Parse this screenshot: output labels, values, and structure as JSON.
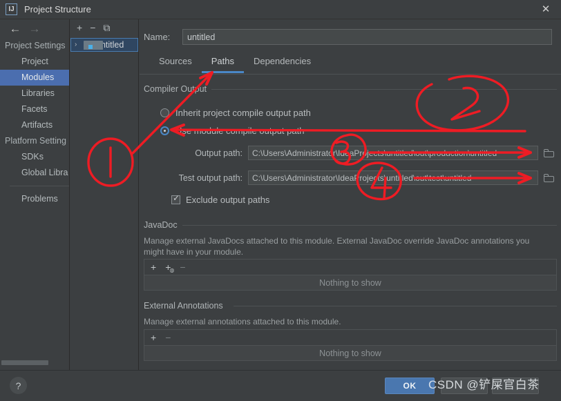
{
  "window": {
    "title": "Project Structure",
    "logo_text": "IJ",
    "close_icon": "✕"
  },
  "nav": {
    "back_icon": "←",
    "forward_icon": "→"
  },
  "sidebar": {
    "groups": [
      {
        "label": "Project Settings",
        "items": [
          {
            "label": "Project",
            "selected": false
          },
          {
            "label": "Modules",
            "selected": true
          },
          {
            "label": "Libraries",
            "selected": false
          },
          {
            "label": "Facets",
            "selected": false
          },
          {
            "label": "Artifacts",
            "selected": false
          }
        ]
      },
      {
        "label": "Platform Setting",
        "items": [
          {
            "label": "SDKs",
            "selected": false
          },
          {
            "label": "Global Libra",
            "selected": false
          }
        ]
      }
    ],
    "problems_label": "Problems"
  },
  "module_panel": {
    "toolbar": {
      "add_icon": "+",
      "remove_icon": "−",
      "copy_icon": "⧉"
    },
    "tree": [
      {
        "label": "untitled",
        "expander": "›",
        "selected": true
      }
    ]
  },
  "form": {
    "name_label": "Name:",
    "name_value": "untitled",
    "name_placeholder": "untitled",
    "tabs": [
      {
        "label": "Sources",
        "active": false
      },
      {
        "label": "Paths",
        "active": true
      },
      {
        "label": "Dependencies",
        "active": false
      }
    ],
    "compiler_output": {
      "section_title": "Compiler Output",
      "radio_inherit": "Inherit project compile output path",
      "radio_module": "Use module compile output path",
      "selected_radio": "module",
      "output_path_label": "Output path:",
      "output_path_value": "C:\\Users\\Administrator\\IdeaProjects\\untitled\\out\\production\\untitled",
      "test_output_path_label": "Test output path:",
      "test_output_path_value": "C:\\Users\\Administrator\\IdeaProjects\\untitled\\out\\test\\untitled",
      "browse_icon": "folder-browse-icon",
      "exclude_label": "Exclude output paths",
      "exclude_checked": true
    },
    "javadoc": {
      "section_title": "JavaDoc",
      "description": "Manage external JavaDocs attached to this module. External JavaDoc override JavaDoc annotations you might have in your module.",
      "add_icon": "+",
      "add_url_icon": "+",
      "remove_icon": "−",
      "empty_text": "Nothing to show"
    },
    "external_annotations": {
      "section_title": "External Annotations",
      "description": "Manage external annotations attached to this module.",
      "add_icon": "+",
      "remove_icon": "−",
      "empty_text": "Nothing to show"
    }
  },
  "footer": {
    "help_icon": "?",
    "ok_label": "OK",
    "watermark": "CSDN @铲屎官白茶"
  },
  "annotations": {
    "marks": [
      "1",
      "2",
      "3",
      "4"
    ],
    "color": "#ee1c24"
  }
}
